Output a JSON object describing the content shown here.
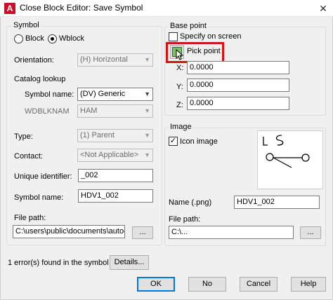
{
  "window": {
    "title": "Close Block Editor: Save Symbol",
    "close_glyph": "✕",
    "app_icon_glyph": "A"
  },
  "symbol": {
    "group_title": "Symbol",
    "type_block_label": "Block",
    "type_wblock_label": "Wblock",
    "selected_type": "Wblock",
    "orientation_label": "Orientation:",
    "orientation_value": "(H) Horizontal",
    "catalog_lookup_label": "Catalog lookup",
    "symbol_name_label": "Symbol name:",
    "symbol_name_value": "(DV) Generic",
    "wdblknam_label": "WDBLKNAM",
    "wdblknam_value": "HAM",
    "type_label": "Type:",
    "type_value": "(1) Parent",
    "contact_label": "Contact:",
    "contact_value": "<Not Applicable>",
    "unique_identifier_label": "Unique identifier:",
    "unique_identifier_value": "_002",
    "symbol_name2_label": "Symbol name:",
    "symbol_name2_value": "HDV1_002",
    "file_path_label": "File path:",
    "file_path_value": "C:\\users\\public\\documents\\autodesk\\aca",
    "browse_label": "..."
  },
  "base_point": {
    "group_title": "Base point",
    "specify_on_screen_label": "Specify on screen",
    "specify_on_screen_checked": false,
    "pick_point_label": "Pick point",
    "x_label": "X:",
    "x_value": "0.0000",
    "y_label": "Y:",
    "y_value": "0.0000",
    "z_label": "Z:",
    "z_value": "0.0000"
  },
  "image": {
    "group_title": "Image",
    "icon_image_label": "Icon image",
    "icon_image_checked": true,
    "check_glyph": "✓",
    "name_label": "Name (.png)",
    "name_value": "HDV1_002",
    "file_path_label": "File path:",
    "file_path_value": "C:\\...",
    "browse_label": "..."
  },
  "footer": {
    "errors_text": "1 error(s) found in the symbol",
    "details_label": "Details...",
    "ok_label": "OK",
    "no_label": "No",
    "cancel_label": "Cancel",
    "help_label": "Help"
  },
  "colors": {
    "highlight": "#d01717",
    "default_button_border": "#0078d7"
  }
}
